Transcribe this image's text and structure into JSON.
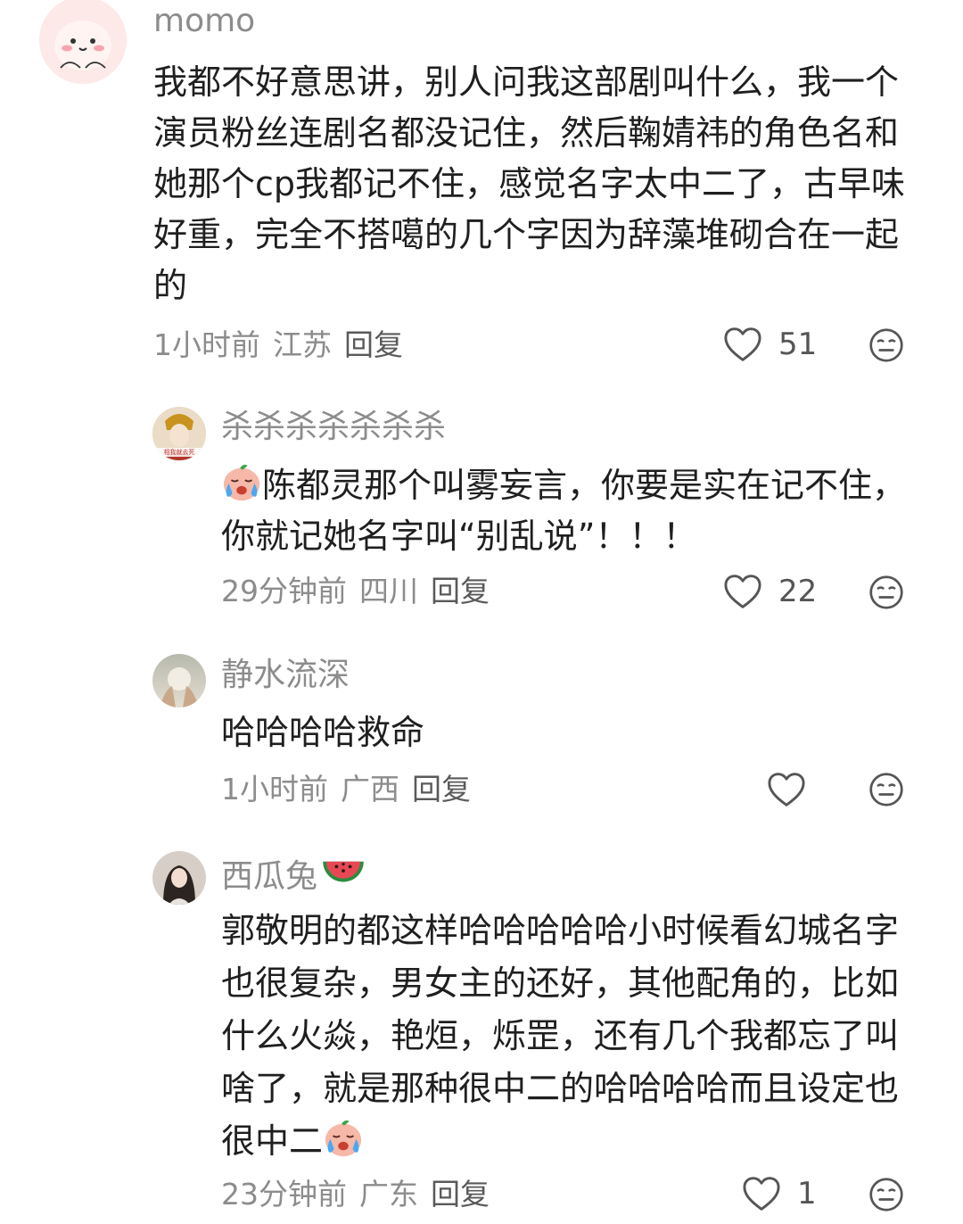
{
  "comments": [
    {
      "username": "momo",
      "text": "我都不好意思讲，别人问我这部剧叫什么，我一个演员粉丝连剧名都没记住，然后鞠婧祎的角色名和她那个cp我都记不住，感觉名字太中二了，古早味好重，完全不搭噶的几个字因为辞藻堆砌合在一起的",
      "time": "1小时前",
      "location": "江苏",
      "reply": "回复",
      "likes": "51"
    },
    {
      "username": "杀杀杀杀杀杀杀",
      "avatar_text": "相我就去死",
      "emoji": "crying-face-emoji",
      "text": "陈都灵那个叫雾妄言，你要是实在记不住，你就记她名字叫“别乱说”！！！",
      "time": "29分钟前",
      "location": "四川",
      "reply": "回复",
      "likes": "22"
    },
    {
      "username": "静水流深",
      "text": "哈哈哈哈救命",
      "time": "1小时前",
      "location": "广西",
      "reply": "回复",
      "likes": ""
    },
    {
      "username": "西瓜兔",
      "username_emoji": "watermelon-emoji",
      "text": "郭敬明的都这样哈哈哈哈哈小时候看幻城名字也很复杂，男女主的还好，其他配角的，比如什么火焱，艳烜，烁罡，还有几个我都忘了叫啥了，就是那种很中二的哈哈哈哈而且设定也很中二",
      "text_emoji": "crying-face-emoji",
      "time": "23分钟前",
      "location": "广东",
      "reply": "回复",
      "likes": "1"
    }
  ],
  "colors": {
    "meta": "#8c8c8c",
    "text": "#1f1f1f",
    "icon": "#555555"
  }
}
